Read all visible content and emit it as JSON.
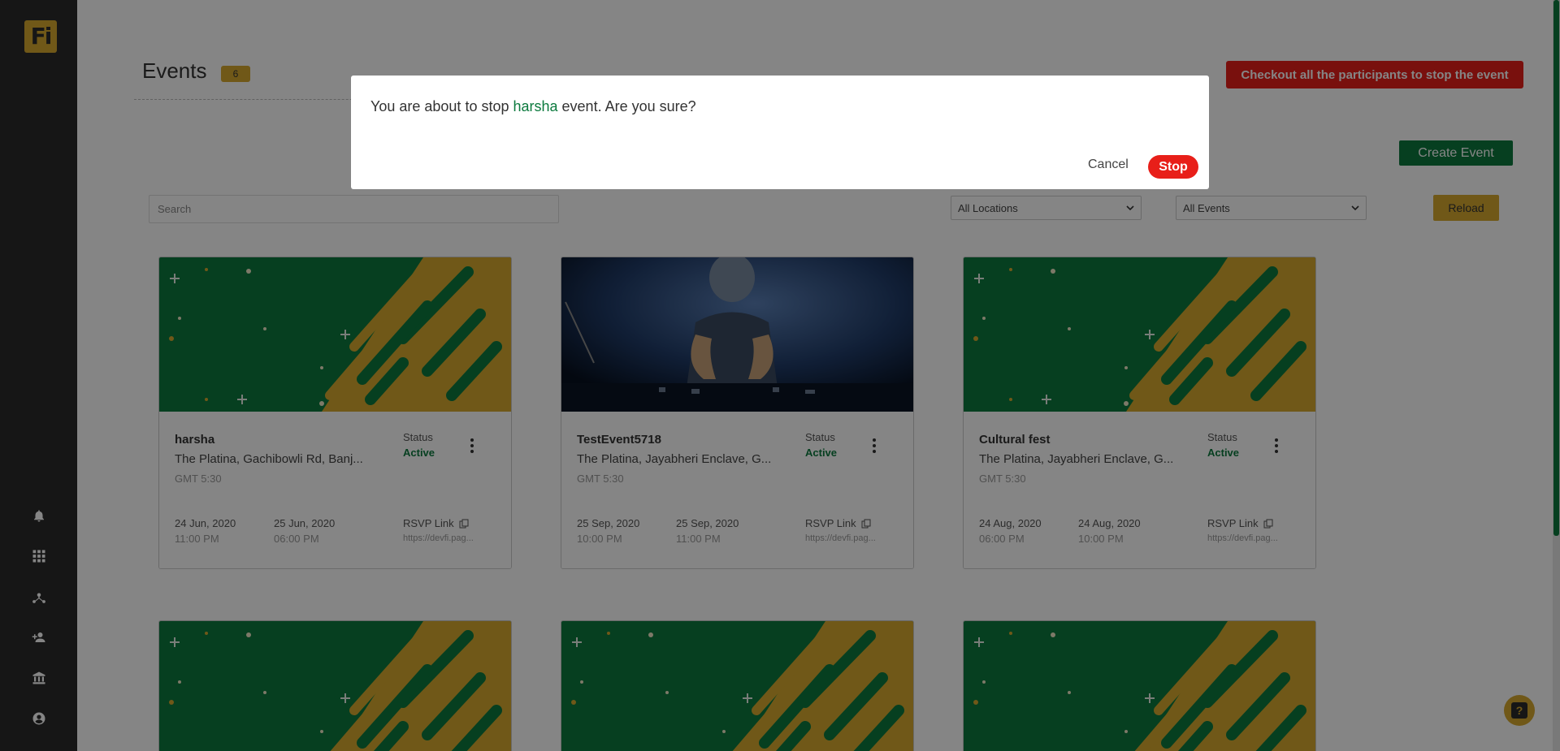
{
  "app": {
    "logo_text": "Fi"
  },
  "sidebar": {
    "icons": [
      "bell-icon",
      "grid-icon",
      "network-icon",
      "add-user-icon",
      "bank-icon",
      "account-icon"
    ]
  },
  "header": {
    "title": "Events",
    "count": "6",
    "checkout_label": "Checkout all the participants to stop the event",
    "create_label": "Create Event"
  },
  "filters": {
    "search_placeholder": "Search",
    "locations": "All Locations",
    "events": "All Events",
    "reload_label": "Reload"
  },
  "cards": [
    {
      "name": "harsha",
      "location": "The Platina, Gachibowli Rd, Banj...",
      "tz": "GMT 5:30",
      "status_label": "Status",
      "status": "Active",
      "start_date": "24 Jun, 2020",
      "start_time": "11:00 PM",
      "end_date": "25 Jun, 2020",
      "end_time": "06:00 PM",
      "rsvp_label": "RSVP Link",
      "rsvp_url": "https://devfi.pag..."
    },
    {
      "name": "TestEvent5718",
      "location": "The Platina, Jayabheri Enclave, G...",
      "tz": "GMT 5:30",
      "status_label": "Status",
      "status": "Active",
      "start_date": "25 Sep, 2020",
      "start_time": "10:00 PM",
      "end_date": "25 Sep, 2020",
      "end_time": "11:00 PM",
      "rsvp_label": "RSVP Link",
      "rsvp_url": "https://devfi.pag..."
    },
    {
      "name": "Cultural fest",
      "location": "The Platina, Jayabheri Enclave, G...",
      "tz": "GMT 5:30",
      "status_label": "Status",
      "status": "Active",
      "start_date": "24 Aug, 2020",
      "start_time": "06:00 PM",
      "end_date": "24 Aug, 2020",
      "end_time": "10:00 PM",
      "rsvp_label": "RSVP Link",
      "rsvp_url": "https://devfi.pag..."
    }
  ],
  "modal": {
    "msg_before": "You are about to stop ",
    "event_name": "harsha",
    "msg_after": " event. Are you sure?",
    "cancel_label": "Cancel",
    "stop_label": "Stop"
  },
  "help": {
    "label": "?"
  },
  "colors": {
    "green": "#0c7a3e",
    "gold": "#d6a92e",
    "red": "#e81f19",
    "sidebar": "#2b2b2b"
  }
}
